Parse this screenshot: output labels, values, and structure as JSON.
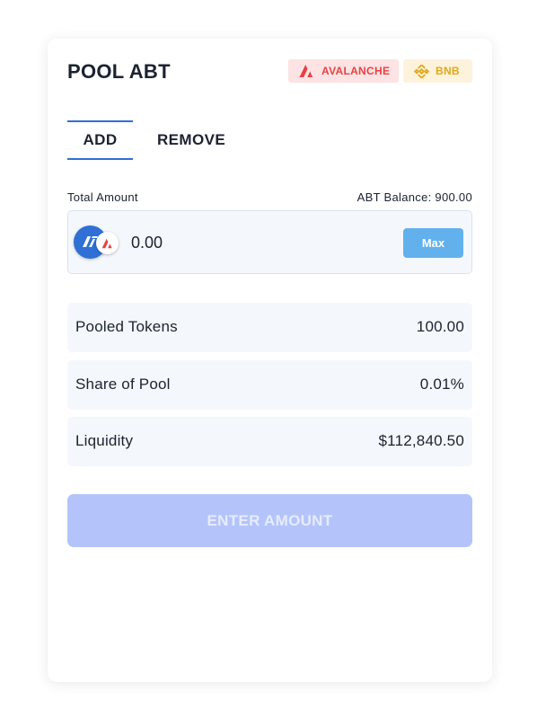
{
  "header": {
    "title": "POOL ABT",
    "chains": [
      {
        "label": "AVALANCHE",
        "icon": "avalanche-icon",
        "color": "#e84142"
      },
      {
        "label": "BNB",
        "icon": "bnb-icon",
        "color": "#e3a71a"
      }
    ]
  },
  "tabs": [
    {
      "label": "ADD",
      "active": true
    },
    {
      "label": "REMOVE",
      "active": false
    }
  ],
  "amount": {
    "label": "Total Amount",
    "balance": "ABT Balance: 900.00",
    "placeholder": "0.00",
    "max_label": "Max",
    "token_icon": "abt-token-icon",
    "chain_icon": "avalanche-icon"
  },
  "stats": [
    {
      "label": "Pooled Tokens",
      "value": "100.00"
    },
    {
      "label": "Share of Pool",
      "value": "0.01%"
    },
    {
      "label": "Liquidity",
      "value": "$112,840.50"
    }
  ],
  "submit": {
    "label": "ENTER AMOUNT",
    "color": "#b4c4fb"
  },
  "colors": {
    "accent": "#2f6fd6",
    "max_button": "#62b1ec",
    "panel_bg": "#f4f8fc"
  }
}
